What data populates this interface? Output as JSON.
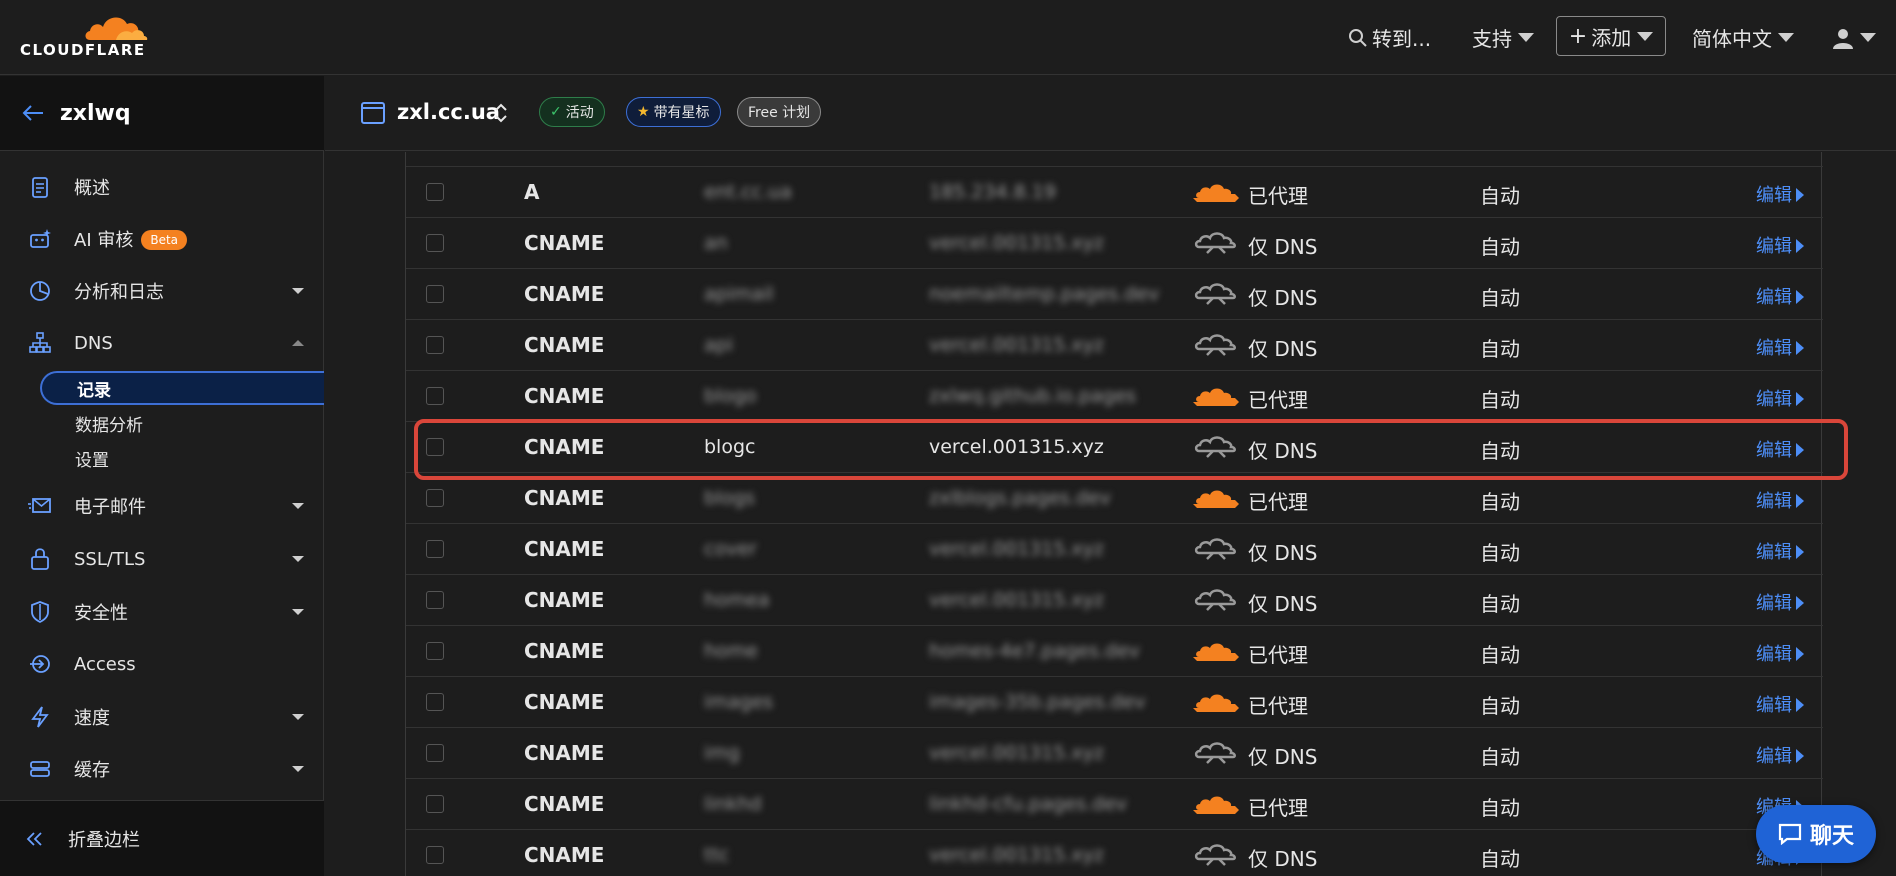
{
  "brand": {
    "logo_text": "CLOUDFLARE",
    "accent": "#f48120"
  },
  "topbar": {
    "search_label": "转到...",
    "support_label": "支持",
    "add_label": "添加",
    "language_label": "简体中文"
  },
  "account": {
    "name": "zxlwq"
  },
  "sidebar": {
    "items": [
      {
        "label": "概述",
        "icon": "clipboard-icon"
      },
      {
        "label": "AI 审核",
        "badge": "Beta",
        "icon": "robot-icon"
      },
      {
        "label": "分析和日志",
        "icon": "pie-chart-icon"
      },
      {
        "label": "DNS",
        "icon": "sitemap-icon"
      },
      {
        "label": "电子邮件",
        "icon": "envelope-icon"
      },
      {
        "label": "SSL/TLS",
        "icon": "lock-icon"
      },
      {
        "label": "安全性",
        "icon": "shield-icon"
      },
      {
        "label": "Access",
        "icon": "access-icon"
      },
      {
        "label": "速度",
        "icon": "bolt-icon"
      },
      {
        "label": "缓存",
        "icon": "server-icon"
      }
    ],
    "dns_sub": [
      "记录",
      "数据分析",
      "设置"
    ],
    "collapse_label": "折叠边栏"
  },
  "zone": {
    "name": "zxl.cc.ua",
    "status_label": "活动",
    "star_label": "带有星标",
    "plan_label": "Free 计划"
  },
  "records": [
    {
      "type": "A",
      "name": "",
      "content": "",
      "proxy": "已代理",
      "proxied": true,
      "ttl": "自动",
      "edit": "编辑"
    },
    {
      "type": "CNAME",
      "name": "",
      "content": "",
      "proxy": "仅 DNS",
      "proxied": false,
      "ttl": "自动",
      "edit": "编辑"
    },
    {
      "type": "CNAME",
      "name": "",
      "content": "",
      "proxy": "仅 DNS",
      "proxied": false,
      "ttl": "自动",
      "edit": "编辑"
    },
    {
      "type": "CNAME",
      "name": "",
      "content": "",
      "proxy": "仅 DNS",
      "proxied": false,
      "ttl": "自动",
      "edit": "编辑"
    },
    {
      "type": "CNAME",
      "name": "",
      "content": "",
      "proxy": "已代理",
      "proxied": true,
      "ttl": "自动",
      "edit": "编辑"
    },
    {
      "type": "CNAME",
      "name": "blogc",
      "content": "vercel.001315.xyz",
      "proxy": "仅 DNS",
      "proxied": false,
      "ttl": "自动",
      "edit": "编辑"
    },
    {
      "type": "CNAME",
      "name": "",
      "content": "",
      "proxy": "已代理",
      "proxied": true,
      "ttl": "自动",
      "edit": "编辑"
    },
    {
      "type": "CNAME",
      "name": "",
      "content": "",
      "proxy": "仅 DNS",
      "proxied": false,
      "ttl": "自动",
      "edit": "编辑"
    },
    {
      "type": "CNAME",
      "name": "",
      "content": "",
      "proxy": "仅 DNS",
      "proxied": false,
      "ttl": "自动",
      "edit": "编辑"
    },
    {
      "type": "CNAME",
      "name": "",
      "content": "",
      "proxy": "已代理",
      "proxied": true,
      "ttl": "自动",
      "edit": "编辑"
    },
    {
      "type": "CNAME",
      "name": "",
      "content": "",
      "proxy": "已代理",
      "proxied": true,
      "ttl": "自动",
      "edit": "编辑"
    },
    {
      "type": "CNAME",
      "name": "",
      "content": "",
      "proxy": "仅 DNS",
      "proxied": false,
      "ttl": "自动",
      "edit": "编辑"
    },
    {
      "type": "CNAME",
      "name": "",
      "content": "",
      "proxy": "已代理",
      "proxied": true,
      "ttl": "自动",
      "edit": "编辑"
    },
    {
      "type": "CNAME",
      "name": "",
      "content": "",
      "proxy": "仅 DNS",
      "proxied": false,
      "ttl": "自动",
      "edit": "编辑"
    }
  ],
  "chat": {
    "label": "聊天"
  }
}
